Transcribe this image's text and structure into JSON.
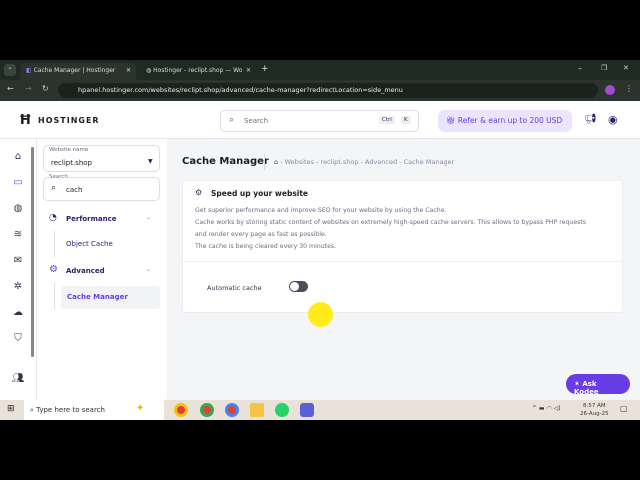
{
  "browser": {
    "tabs": [
      {
        "label": "Cache Manager | Hostinger",
        "active": true
      },
      {
        "label": "Hostinger - reclipt.shop — Wo",
        "active": false
      }
    ],
    "url": "hpanel.hostinger.com/websites/reclipt.shop/advanced/cache-manager?redirectLocation=side_menu"
  },
  "header": {
    "logo": "HOSTINGER",
    "search_placeholder": "Search",
    "kbd1": "Ctrl",
    "kbd2": "K",
    "refer": "Refer & earn up to 200 USD"
  },
  "sidebar": {
    "website_label": "Website name",
    "website_value": "reclipt.shop",
    "search_label": "Search",
    "search_value": "cach",
    "items": [
      {
        "label": "Performance"
      },
      {
        "label": "Object Cache"
      },
      {
        "label": "Advanced"
      },
      {
        "label": "Cache Manager",
        "active": true
      }
    ]
  },
  "main": {
    "title": "Cache Manager",
    "breadcrumb": [
      "Websites",
      "reclipt.shop",
      "Advanced",
      "Cache Manager"
    ],
    "card_title": "Speed up your website",
    "desc": [
      "Get superior performance and improve SEO for your website by using the Cache.",
      "Cache works by storing static content of websites on extremely high-speed cache servers. This allows to bypass PHP requests",
      "and render every page as fast as possible.",
      "The cache is being cleared every 30 minutes."
    ],
    "toggle_label": "Automatic cache",
    "toggle_on": false,
    "ask": "Ask Kodee"
  },
  "taskbar": {
    "search_placeholder": "Type here to search",
    "time": "8:57 AM",
    "date": "26-Aug-25"
  },
  "colors": {
    "accent": "#673de6",
    "refer_bg": "#ebe4ff"
  }
}
